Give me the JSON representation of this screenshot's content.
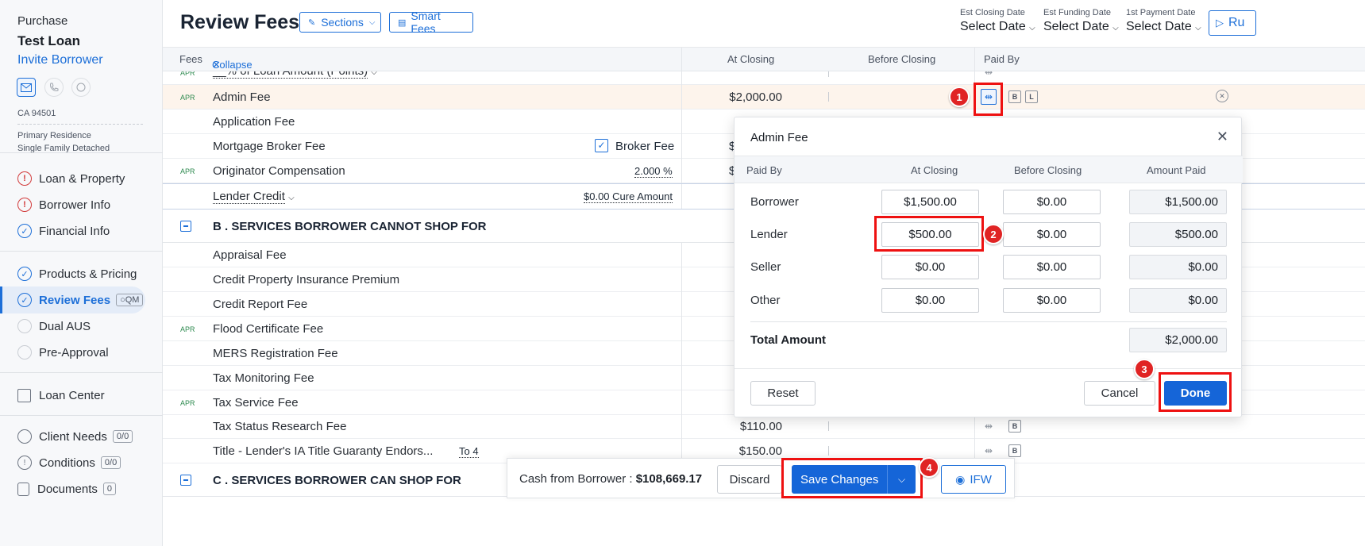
{
  "sidebar": {
    "purpose": "Purchase",
    "loan_name": "Test Loan",
    "invite": "Invite Borrower",
    "zip": "CA 94501",
    "occupancy": "Primary Residence",
    "property_type": "Single Family Detached",
    "nav": [
      {
        "label": "Loan & Property",
        "state": "warn"
      },
      {
        "label": "Borrower Info",
        "state": "warn"
      },
      {
        "label": "Financial Info",
        "state": "check"
      },
      {
        "label": "Products & Pricing",
        "state": "check"
      },
      {
        "label": "Review Fees",
        "state": "check",
        "badge": "QM"
      },
      {
        "label": "Dual AUS",
        "state": "empty"
      },
      {
        "label": "Pre-Approval",
        "state": "empty"
      },
      {
        "label": "Loan Center"
      },
      {
        "label": "Client Needs",
        "badge": "0/0"
      },
      {
        "label": "Conditions",
        "badge": "0/0"
      },
      {
        "label": "Documents",
        "badge": "0"
      }
    ]
  },
  "header": {
    "title": "Review Fees",
    "sections_btn": "Sections",
    "smart_fees_btn": "Smart Fees",
    "dates": [
      {
        "label": "Est Closing Date",
        "value": "Select Date"
      },
      {
        "label": "Est Funding Date",
        "value": "Select Date"
      },
      {
        "label": "1st Payment Date",
        "value": "Select Date"
      }
    ],
    "run_btn": "Ru"
  },
  "columns": {
    "fees": "Fees",
    "collapse": "Collapse",
    "at_closing": "At Closing",
    "before_closing": "Before Closing",
    "paid_by": "Paid By"
  },
  "fees": {
    "partial_row": "__% of Loan Amount (Points)",
    "apr_tag": "APR",
    "admin_fee": {
      "name": "Admin Fee",
      "amount": "$2,000.00",
      "b": "B",
      "l": "L"
    },
    "application_fee": "Application Fee",
    "mortgage_broker_fee": "Mortgage Broker Fee",
    "broker_fee_label": "Broker Fee",
    "broker_amt_partial": "$",
    "originator_comp": "Originator Compensation",
    "originator_pct": "2.000 %",
    "originator_amt_partial": "$",
    "lender_credit": "Lender Credit",
    "cure_amount": "$0.00 Cure Amount",
    "section_b": "B . SERVICES BORROWER CANNOT SHOP FOR",
    "section_b_rows": [
      {
        "name": "Appraisal Fee",
        "apr": false
      },
      {
        "name": "Credit Property Insurance Premium",
        "apr": false
      },
      {
        "name": "Credit Report Fee",
        "apr": false
      },
      {
        "name": "Flood Certificate Fee",
        "apr": true
      },
      {
        "name": "MERS Registration Fee",
        "apr": false
      },
      {
        "name": "Tax Monitoring Fee",
        "apr": false
      },
      {
        "name": "Tax Service Fee",
        "apr": true
      }
    ],
    "tax_status": {
      "name": "Tax Status Research Fee",
      "amount": "$110.00",
      "b": "B"
    },
    "title_lender": {
      "name": "Title - Lender's IA Title Guaranty Endors...",
      "to": "To 4",
      "amount": "$150.00",
      "b": "B"
    },
    "section_c": "C . SERVICES BORROWER CAN SHOP FOR"
  },
  "modal": {
    "title": "Admin Fee",
    "columns": [
      "Paid By",
      "At Closing",
      "Before Closing",
      "Amount Paid"
    ],
    "rows": [
      {
        "label": "Borrower",
        "at_closing": "$1,500.00",
        "before_closing": "$0.00",
        "amount_paid": "$1,500.00"
      },
      {
        "label": "Lender",
        "at_closing": "$500.00",
        "before_closing": "$0.00",
        "amount_paid": "$500.00"
      },
      {
        "label": "Seller",
        "at_closing": "$0.00",
        "before_closing": "$0.00",
        "amount_paid": "$0.00"
      },
      {
        "label": "Other",
        "at_closing": "$0.00",
        "before_closing": "$0.00",
        "amount_paid": "$0.00"
      }
    ],
    "total_label": "Total Amount",
    "total_value": "$2,000.00",
    "reset": "Reset",
    "cancel": "Cancel",
    "done": "Done"
  },
  "bottom": {
    "cash_label": "Cash from Borrower :",
    "cash_value": "$108,669.17",
    "discard": "Discard",
    "save": "Save Changes",
    "ifw": "IFW"
  },
  "annotations": [
    "1",
    "2",
    "3",
    "4"
  ],
  "colors": {
    "accent": "#1d6fd8",
    "annotation": "#e11111",
    "warning": "#d23b3b",
    "apr": "#2e8a4f"
  }
}
